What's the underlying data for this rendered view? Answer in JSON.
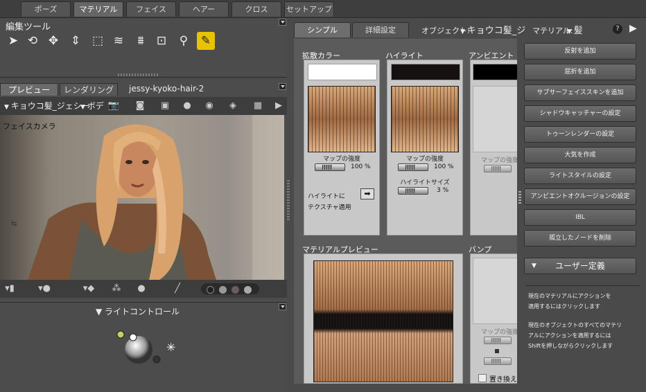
{
  "top_tabs": [
    "ポーズ",
    "マテリアル",
    "フェイス",
    "ヘアー",
    "クロス",
    "セットアップ"
  ],
  "edit_tools": {
    "title": "編集ツール",
    "tools": [
      "arrow-icon",
      "rotate-icon",
      "move-icon",
      "up-down-icon",
      "scale-icon",
      "layers-icon",
      "taper-icon",
      "frame-icon",
      "magnifier-icon",
      "eyedropper-icon"
    ]
  },
  "preview": {
    "tabs": [
      "プレビュー",
      "レンダリング"
    ],
    "scene_name": "jessy-kyoko-hair-2",
    "figure_dropdown": "キョウコ髪_ジェシー",
    "part_dropdown": "ボデ",
    "camera_label": "フェイスカメラ"
  },
  "light_control": {
    "title": "ライトコントロール"
  },
  "material": {
    "tabs": [
      "シンプル",
      "詳細設定"
    ],
    "object_label": "オブジェクト:",
    "object_value": "キョウコ髪_ジ",
    "material_label": "マテリアル:",
    "material_value": "髪",
    "diffuse": {
      "label": "拡散カラー",
      "strength_label": "マップの強度",
      "strength_value": "100 %",
      "apply_label_1": "ハイライトに",
      "apply_label_2": "テクスチャ適用"
    },
    "highlight": {
      "label": "ハイライト",
      "strength_label": "マップの強度",
      "strength_value": "100 %",
      "size_label": "ハイライトサイズ",
      "size_value": "3 %"
    },
    "ambient": {
      "label": "アンビエント",
      "strength_label": "マップの強度"
    },
    "preview_label": "マテリアルプレビュー",
    "bump": {
      "label": "バンプ",
      "strength_label": "マップの強度",
      "replace_label": "置き換え"
    }
  },
  "actions": {
    "buttons": [
      "反射を追加",
      "屈折を追加",
      "サブサーフェイススキンを追加",
      "シャドウキャッチャーの設定",
      "トゥーンレンダーの設定",
      "大気を作成",
      "ライトスタイルの設定",
      "アンビエントオクルージョンの設定",
      "IBL",
      "孤立したノードを削除"
    ],
    "user_defined": "ユーザー定義",
    "help_1": "現在のマテリアルにアクションを",
    "help_2": "適用するにはクリックします",
    "help_3": "現在のオブジェクトのすべてのマテリ",
    "help_4": "アルにアクションを適用するには",
    "help_5": "Shiftを押しながらクリックします"
  }
}
